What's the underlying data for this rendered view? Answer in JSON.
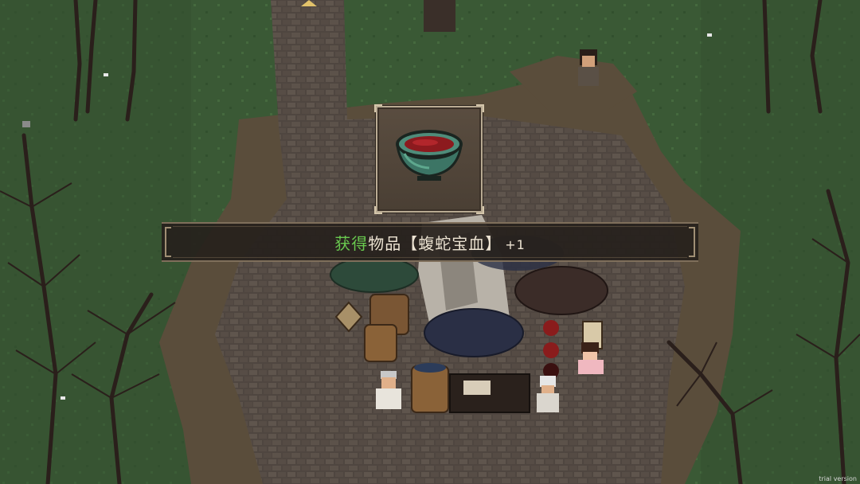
{
  "notification": {
    "verb": "获得",
    "noun": "物品",
    "bracket_open": "【",
    "item_name": "蝮蛇宝血",
    "bracket_close": "】",
    "quantity": "+1"
  },
  "item_icon": "blood-bowl-icon",
  "watermark": "trial version",
  "colors": {
    "verb_green": "#69c94f",
    "text": "#ece3d2",
    "banner_bg": "#26211c",
    "grass": "#3b5a36",
    "path_stone": "#5b5149"
  }
}
